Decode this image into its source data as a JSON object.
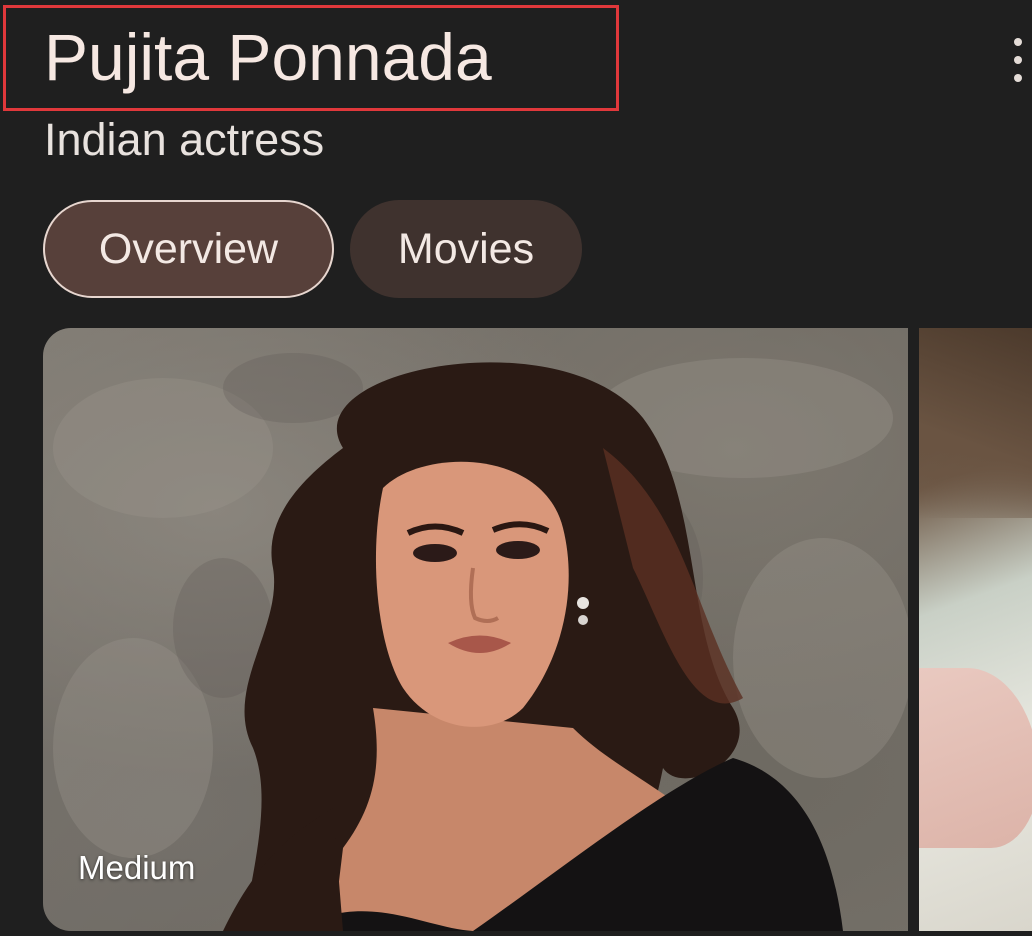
{
  "entity": {
    "name": "Pujita Ponnada",
    "description": "Indian actress"
  },
  "tabs": [
    {
      "label": "Overview",
      "selected": true
    },
    {
      "label": "Movies",
      "selected": false
    }
  ],
  "images": [
    {
      "source": "Medium"
    }
  ],
  "colors": {
    "background": "#1f1f1f",
    "highlight_box": "#e0383b",
    "chip_selected": "#57403a",
    "chip_default": "#3f322e"
  },
  "icons": {
    "more": "more-vert-icon"
  }
}
